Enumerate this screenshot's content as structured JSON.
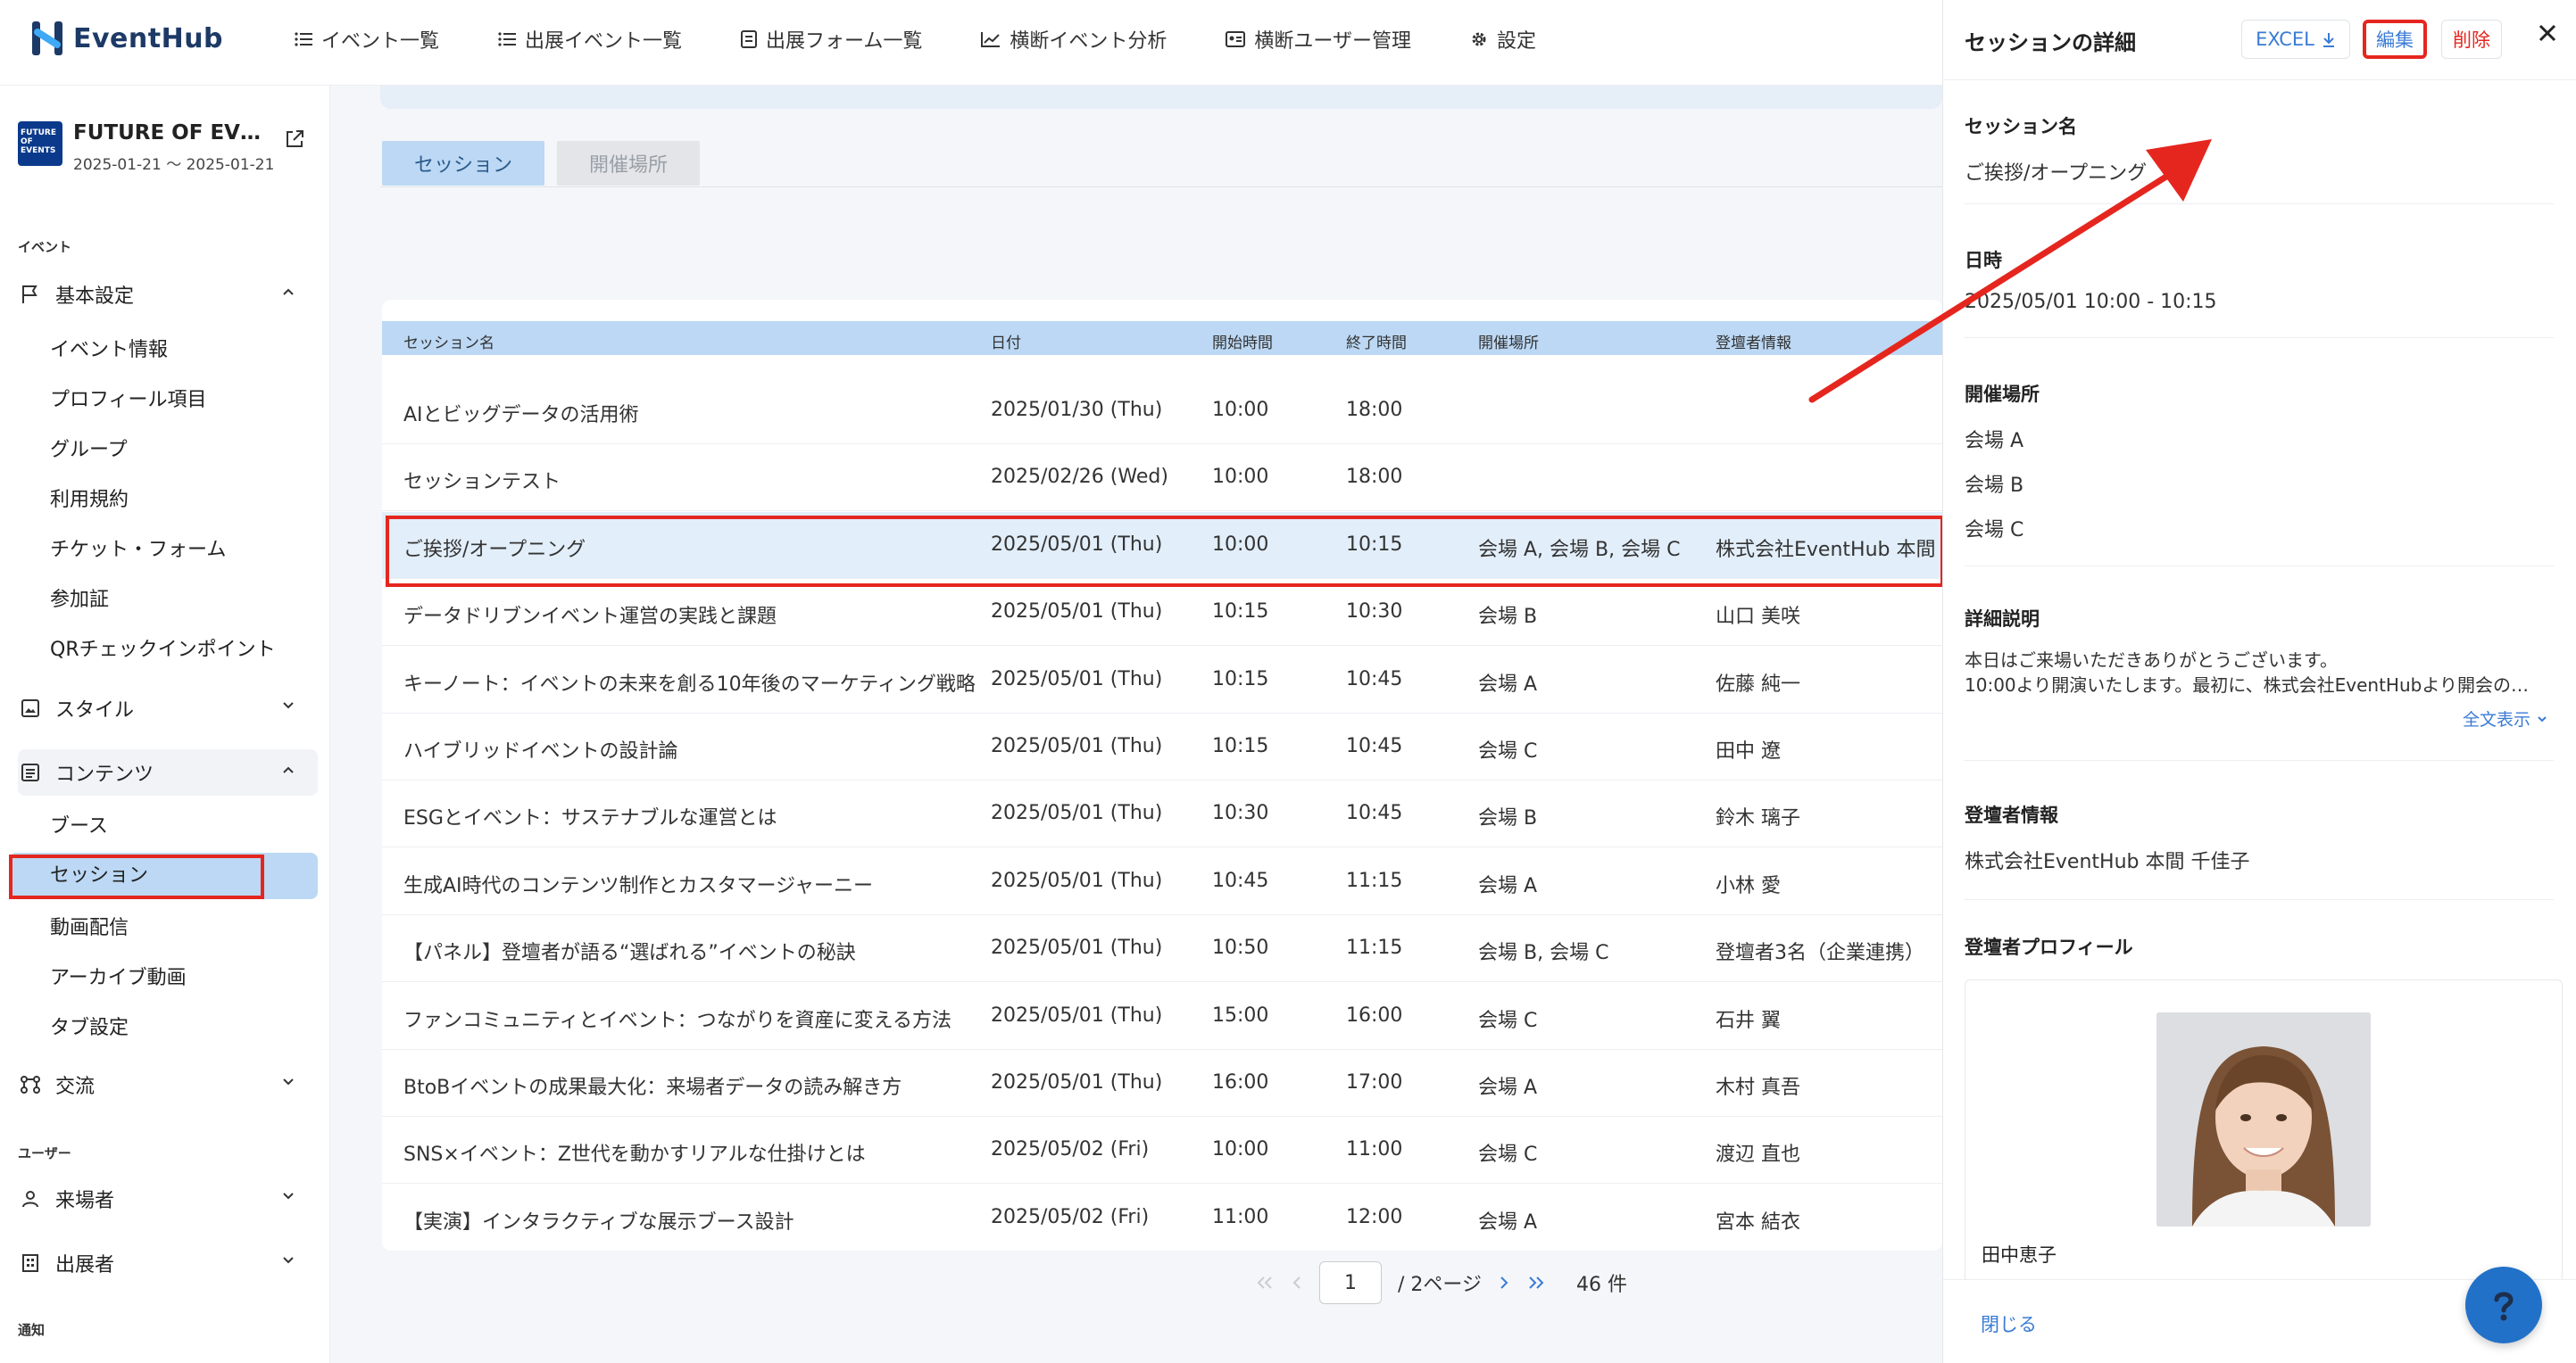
{
  "brand": {
    "name": "EventHub"
  },
  "nav": [
    {
      "label": "イベント一覧",
      "icon": "list-icon"
    },
    {
      "label": "出展イベント一覧",
      "icon": "list-icon"
    },
    {
      "label": "出展フォーム一覧",
      "icon": "form-icon"
    },
    {
      "label": "横断イベント分析",
      "icon": "chart-icon"
    },
    {
      "label": "横断ユーザー管理",
      "icon": "user-card-icon"
    },
    {
      "label": "設定",
      "icon": "gear-icon"
    }
  ],
  "event": {
    "title": "FUTURE OF EVEN…",
    "dates": "2025-01-21 〜 2025-01-21",
    "thumb_text": "FUTURE OF EVENTS"
  },
  "sidebar": {
    "section_event": "イベント",
    "section_user": "ユーザー",
    "section_notify": "通知",
    "groups": {
      "basic": "基本設定",
      "style": "スタイル",
      "contents": "コンテンツ",
      "exchange": "交流",
      "visitors": "来場者",
      "exhibitors": "出展者"
    },
    "basic_items": [
      "イベント情報",
      "プロフィール項目",
      "グループ",
      "利用規約",
      "チケット・フォーム",
      "参加証",
      "QRチェックインポイント"
    ],
    "content_items": [
      "ブース",
      "セッション",
      "動画配信",
      "アーカイブ動画",
      "タブ設定"
    ]
  },
  "tabs": [
    "セッション",
    "開催場所"
  ],
  "table": {
    "headers": [
      "セッション名",
      "日付",
      "開始時間",
      "終了時間",
      "開催場所",
      "登壇者情報"
    ],
    "rows": [
      [
        "AIとビッグデータの活用術",
        "2025/01/30 (Thu)",
        "10:00",
        "18:00",
        "",
        ""
      ],
      [
        "セッションテスト",
        "2025/02/26 (Wed)",
        "10:00",
        "18:00",
        "",
        ""
      ],
      [
        "ご挨拶/オープニング",
        "2025/05/01 (Thu)",
        "10:00",
        "10:15",
        "会場 A, 会場 B, 会場 C",
        "株式会社EventHub 本間 千"
      ],
      [
        "データドリブンイベント運営の実践と課題",
        "2025/05/01 (Thu)",
        "10:15",
        "10:30",
        "会場 B",
        "山口 美咲"
      ],
      [
        "キーノート：イベントの未来を創る10年後のマーケティング戦略",
        "2025/05/01 (Thu)",
        "10:15",
        "10:45",
        "会場 A",
        "佐藤 純一"
      ],
      [
        "ハイブリッドイベントの設計論",
        "2025/05/01 (Thu)",
        "10:15",
        "10:45",
        "会場 C",
        "田中 遼"
      ],
      [
        "ESGとイベント：サステナブルな運営とは",
        "2025/05/01 (Thu)",
        "10:30",
        "10:45",
        "会場 B",
        "鈴木 璃子"
      ],
      [
        "生成AI時代のコンテンツ制作とカスタマージャーニー",
        "2025/05/01 (Thu)",
        "10:45",
        "11:15",
        "会場 A",
        "小林 愛"
      ],
      [
        "【パネル】登壇者が語る“選ばれる”イベントの秘訣",
        "2025/05/01 (Thu)",
        "10:50",
        "11:15",
        "会場 B, 会場 C",
        "登壇者3名（企業連携）"
      ],
      [
        "ファンコミュニティとイベント：つながりを資産に変える方法",
        "2025/05/01 (Thu)",
        "15:00",
        "16:00",
        "会場 C",
        "石井 翼"
      ],
      [
        "BtoBイベントの成果最大化：来場者データの読み解き方",
        "2025/05/01 (Thu)",
        "16:00",
        "17:00",
        "会場 A",
        "木村 真吾"
      ],
      [
        "SNS×イベント：Z世代を動かすリアルな仕掛けとは",
        "2025/05/02 (Fri)",
        "10:00",
        "11:00",
        "会場 C",
        "渡辺 直也"
      ],
      [
        "【実演】インタラクティブな展示ブース設計",
        "2025/05/02 (Fri)",
        "11:00",
        "12:00",
        "会場 A",
        "宮本 結衣"
      ]
    ]
  },
  "pager": {
    "page": "1",
    "total": "/ 2ページ",
    "count": "46 件"
  },
  "panel": {
    "title": "セッションの詳細",
    "excel": "EXCEL",
    "edit": "編集",
    "delete": "削除",
    "name_label": "セッション名",
    "name_value": "ご挨拶/オープニング",
    "date_label": "日時",
    "date_value": "2025/05/01 10:00 - 10:15",
    "venue_label": "開催場所",
    "venues": [
      "会場 A",
      "会場 B",
      "会場 C"
    ],
    "desc_label": "詳細説明",
    "desc_lines": [
      "本日はご来場いただきありがとうございます。",
      "10:00より開演いたします。最初に、株式会社EventHubより開会の…"
    ],
    "more": "全文表示",
    "speaker_label": "登壇者情報",
    "speaker_value": "株式会社EventHub 本間 千佳子",
    "profile_label": "登壇者プロフィール",
    "profile_name": "田中恵子",
    "close": "閉じる"
  },
  "colors": {
    "accent": "#3a7bd5",
    "highlight": "#bcd8f4",
    "annotation": "#e5261f",
    "brand": "#1d3a66"
  }
}
